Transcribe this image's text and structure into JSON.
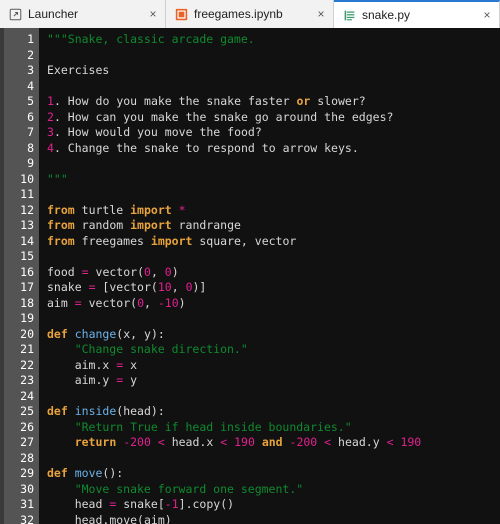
{
  "tabs": [
    {
      "label": "Launcher",
      "icon": "launcher-icon",
      "active": false,
      "close_label": "×"
    },
    {
      "label": "freegames.ipynb",
      "icon": "notebook-icon",
      "active": false,
      "close_label": "×"
    },
    {
      "label": "snake.py",
      "icon": "python-file-icon",
      "active": true,
      "close_label": "×"
    }
  ],
  "colors": {
    "accent": "#2979cf",
    "editor_background": "#111111",
    "gutter_background": "#545454",
    "string": "#0f8a2f",
    "keyword": "#e8a33d",
    "function_name": "#6cb3e8",
    "number": "#e0208f",
    "operator": "#e0208f",
    "text": "#d8d8d8",
    "notebook_icon": "#e8622a",
    "python_icon": "#3c9c6e"
  },
  "editor": {
    "filename": "snake.py",
    "first_line": 1,
    "last_line": 32,
    "line_numbers": [
      1,
      2,
      3,
      4,
      5,
      6,
      7,
      8,
      9,
      10,
      11,
      12,
      13,
      14,
      15,
      16,
      17,
      18,
      19,
      20,
      21,
      22,
      23,
      24,
      25,
      26,
      27,
      28,
      29,
      30,
      31,
      32
    ],
    "lines": [
      "\"\"\"Snake, classic arcade game.",
      "",
      "Exercises",
      "",
      "1. How do you make the snake faster or slower?",
      "2. How can you make the snake go around the edges?",
      "3. How would you move the food?",
      "4. Change the snake to respond to arrow keys.",
      "",
      "\"\"\"",
      "",
      "from turtle import *",
      "from random import randrange",
      "from freegames import square, vector",
      "",
      "food = vector(0, 0)",
      "snake = [vector(10, 0)]",
      "aim = vector(0, -10)",
      "",
      "def change(x, y):",
      "    \"Change snake direction.\"",
      "    aim.x = x",
      "    aim.y = y",
      "",
      "def inside(head):",
      "    \"Return True if head inside boundaries.\"",
      "    return -200 < head.x < 190 and -200 < head.y < 190",
      "",
      "def move():",
      "    \"Move snake forward one segment.\"",
      "    head = snake[-1].copy()",
      "    head.move(aim)"
    ]
  }
}
